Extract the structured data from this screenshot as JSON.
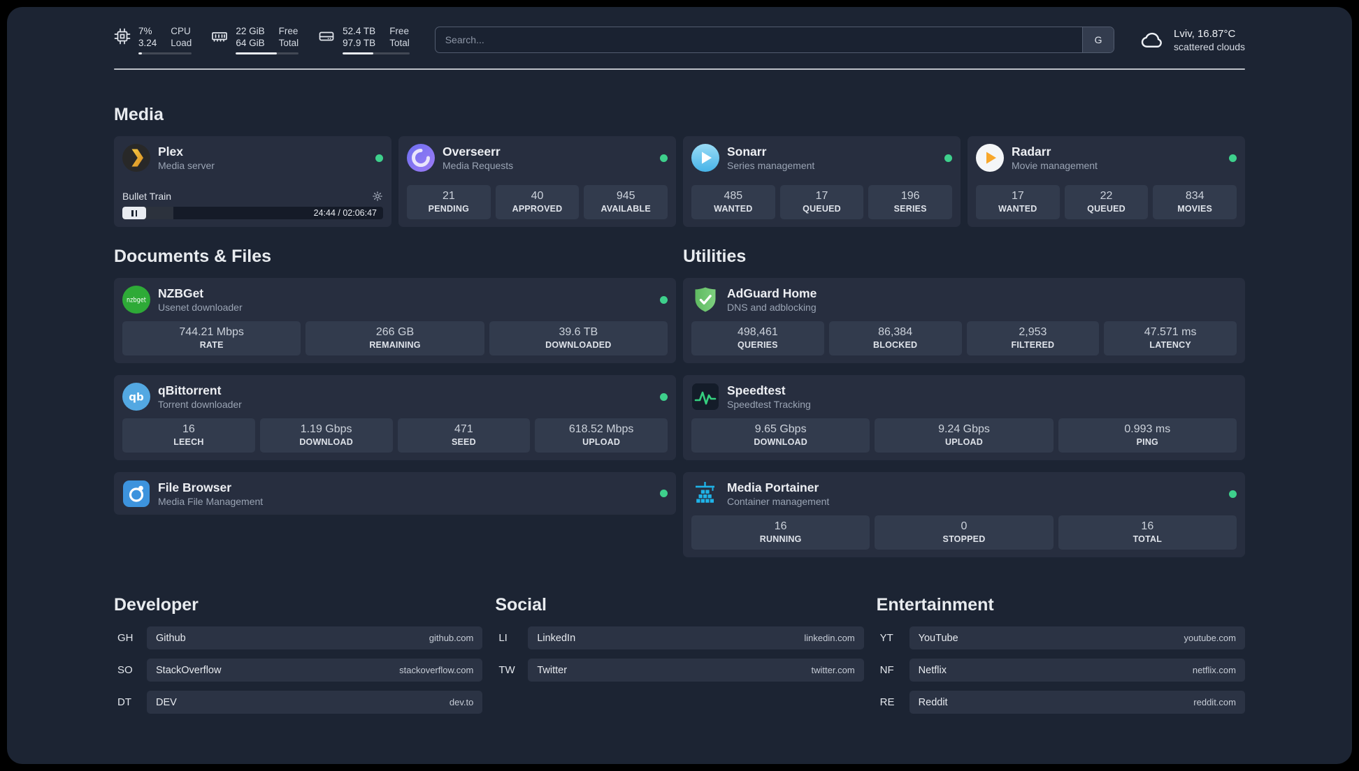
{
  "colors": {
    "status_online": "#3ed08c",
    "accent_green": "#35d07f",
    "background": "#1c2433"
  },
  "icons": {
    "cpu": "chip-icon",
    "memory": "ram-stick-icon",
    "disk": "hard-drive-icon",
    "weather": "cloud-icon",
    "settings": "gear-icon",
    "player_state": "pause-icon",
    "search_provider": "G"
  },
  "topbar": {
    "cpu": {
      "value1": "7%",
      "value2": "3.24",
      "label1": "CPU",
      "label2": "Load",
      "progress_pct": 7
    },
    "memory": {
      "value1": "22 GiB",
      "value2": "64 GiB",
      "label1": "Free",
      "label2": "Total",
      "progress_pct": 65
    },
    "disk": {
      "value1": "52.4 TB",
      "value2": "97.9 TB",
      "label1": "Free",
      "label2": "Total",
      "progress_pct": 46
    },
    "search": {
      "placeholder": "Search...",
      "provider_button": "G"
    },
    "weather": {
      "location_temp": "Lviv, 16.87°C",
      "condition": "scattered clouds"
    }
  },
  "sections": {
    "media": {
      "title": "Media",
      "plex": {
        "name": "Plex",
        "subtitle": "Media server",
        "now_playing": "Bullet Train",
        "time": "24:44 / 02:06:47",
        "progress_pct": 19.5
      },
      "overseerr": {
        "name": "Overseerr",
        "subtitle": "Media Requests",
        "stats": [
          {
            "value": "21",
            "label": "PENDING"
          },
          {
            "value": "40",
            "label": "APPROVED"
          },
          {
            "value": "945",
            "label": "AVAILABLE"
          }
        ]
      },
      "sonarr": {
        "name": "Sonarr",
        "subtitle": "Series management",
        "stats": [
          {
            "value": "485",
            "label": "WANTED"
          },
          {
            "value": "17",
            "label": "QUEUED"
          },
          {
            "value": "196",
            "label": "SERIES"
          }
        ]
      },
      "radarr": {
        "name": "Radarr",
        "subtitle": "Movie management",
        "stats": [
          {
            "value": "17",
            "label": "WANTED"
          },
          {
            "value": "22",
            "label": "QUEUED"
          },
          {
            "value": "834",
            "label": "MOVIES"
          }
        ]
      }
    },
    "documents": {
      "title": "Documents & Files",
      "nzbget": {
        "name": "NZBGet",
        "subtitle": "Usenet downloader",
        "stats": [
          {
            "value": "744.21 Mbps",
            "label": "RATE"
          },
          {
            "value": "266 GB",
            "label": "REMAINING"
          },
          {
            "value": "39.6 TB",
            "label": "DOWNLOADED"
          }
        ]
      },
      "qbittorrent": {
        "name": "qBittorrent",
        "subtitle": "Torrent downloader",
        "stats": [
          {
            "value": "16",
            "label": "LEECH"
          },
          {
            "value": "1.19 Gbps",
            "label": "DOWNLOAD"
          },
          {
            "value": "471",
            "label": "SEED"
          },
          {
            "value": "618.52 Mbps",
            "label": "UPLOAD"
          }
        ]
      },
      "filebrowser": {
        "name": "File Browser",
        "subtitle": "Media File Management"
      }
    },
    "utilities": {
      "title": "Utilities",
      "adguard": {
        "name": "AdGuard Home",
        "subtitle": "DNS and adblocking",
        "stats": [
          {
            "value": "498,461",
            "label": "QUERIES"
          },
          {
            "value": "86,384",
            "label": "BLOCKED"
          },
          {
            "value": "2,953",
            "label": "FILTERED"
          },
          {
            "value": "47.571 ms",
            "label": "LATENCY"
          }
        ]
      },
      "speedtest": {
        "name": "Speedtest",
        "subtitle": "Speedtest Tracking",
        "stats": [
          {
            "value": "9.65 Gbps",
            "label": "DOWNLOAD"
          },
          {
            "value": "9.24 Gbps",
            "label": "UPLOAD"
          },
          {
            "value": "0.993 ms",
            "label": "PING"
          }
        ]
      },
      "portainer": {
        "name": "Media Portainer",
        "subtitle": "Container management",
        "stats": [
          {
            "value": "16",
            "label": "RUNNING"
          },
          {
            "value": "0",
            "label": "STOPPED"
          },
          {
            "value": "16",
            "label": "TOTAL"
          }
        ]
      }
    },
    "bookmarks": {
      "developer": {
        "title": "Developer",
        "items": [
          {
            "abbr": "GH",
            "name": "Github",
            "domain": "github.com"
          },
          {
            "abbr": "SO",
            "name": "StackOverflow",
            "domain": "stackoverflow.com"
          },
          {
            "abbr": "DT",
            "name": "DEV",
            "domain": "dev.to"
          }
        ]
      },
      "social": {
        "title": "Social",
        "items": [
          {
            "abbr": "LI",
            "name": "LinkedIn",
            "domain": "linkedin.com"
          },
          {
            "abbr": "TW",
            "name": "Twitter",
            "domain": "twitter.com"
          }
        ]
      },
      "entertainment": {
        "title": "Entertainment",
        "items": [
          {
            "abbr": "YT",
            "name": "YouTube",
            "domain": "youtube.com"
          },
          {
            "abbr": "NF",
            "name": "Netflix",
            "domain": "netflix.com"
          },
          {
            "abbr": "RE",
            "name": "Reddit",
            "domain": "reddit.com"
          }
        ]
      }
    }
  }
}
